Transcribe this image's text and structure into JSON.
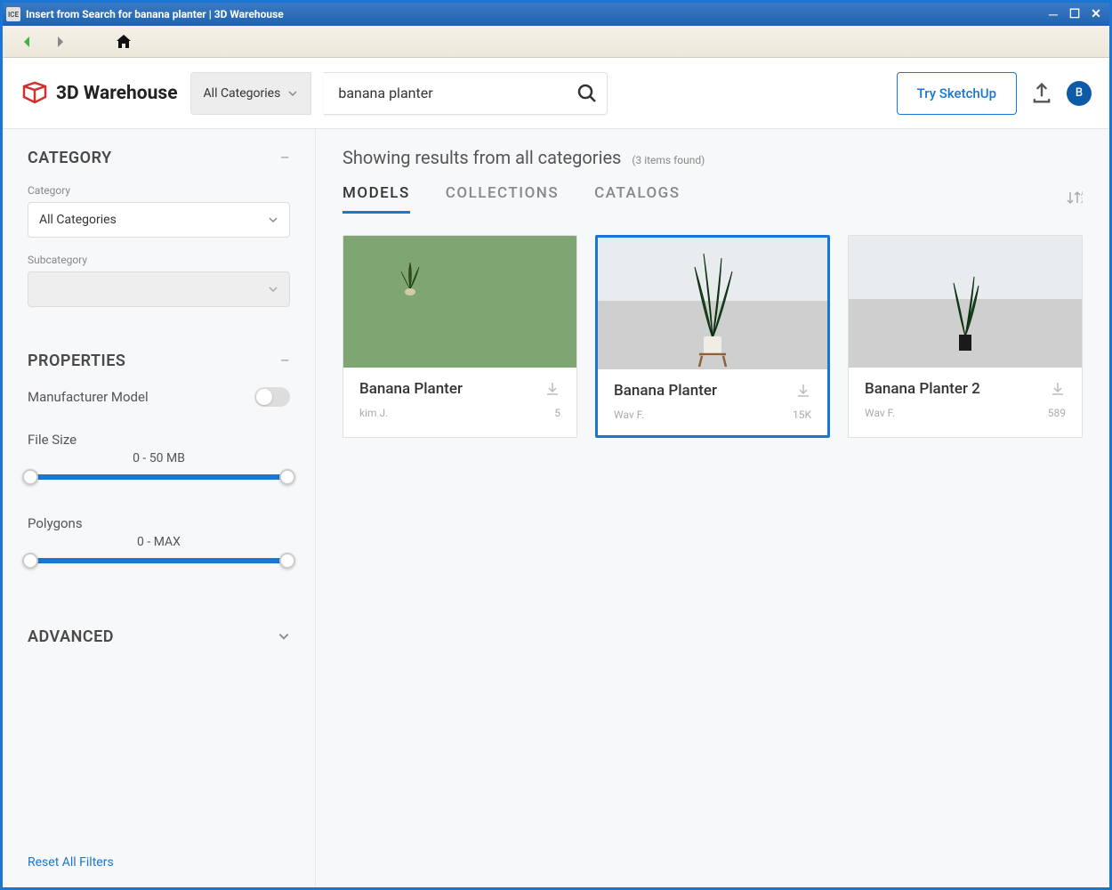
{
  "window": {
    "title": "Insert from Search for banana planter | 3D Warehouse",
    "app_icon_text": "ICE"
  },
  "nav": {
    "back_icon": "←",
    "forward_icon": "→",
    "home_icon": "⌂"
  },
  "header": {
    "logo_text": "3D Warehouse",
    "category_dropdown": "All Categories",
    "search_value": "banana planter",
    "try_button": "Try SketchUp",
    "avatar_letter": "B"
  },
  "sidebar": {
    "category": {
      "title": "CATEGORY",
      "field_label": "Category",
      "selected": "All Categories",
      "sub_label": "Subcategory",
      "sub_selected": ""
    },
    "properties": {
      "title": "PROPERTIES",
      "manufacturer_label": "Manufacturer Model",
      "file_size_label": "File Size",
      "file_size_value": "0 - 50 MB",
      "polygons_label": "Polygons",
      "polygons_value": "0 - MAX"
    },
    "advanced": {
      "title": "ADVANCED"
    },
    "reset_label": "Reset All Filters"
  },
  "content": {
    "results_title": "Showing results from all categories",
    "results_count": "(3 items found)",
    "tabs": [
      "MODELS",
      "COLLECTIONS",
      "CATALOGS"
    ],
    "active_tab": 0,
    "cards": [
      {
        "title": "Banana Planter",
        "author": "kim J.",
        "views": "5",
        "bg": "green",
        "selected": false
      },
      {
        "title": "Banana Planter",
        "author": "Wav F.",
        "views": "15K",
        "bg": "gray",
        "selected": true
      },
      {
        "title": "Banana Planter 2",
        "author": "Wav F.",
        "views": "589",
        "bg": "gray",
        "selected": false
      }
    ]
  }
}
